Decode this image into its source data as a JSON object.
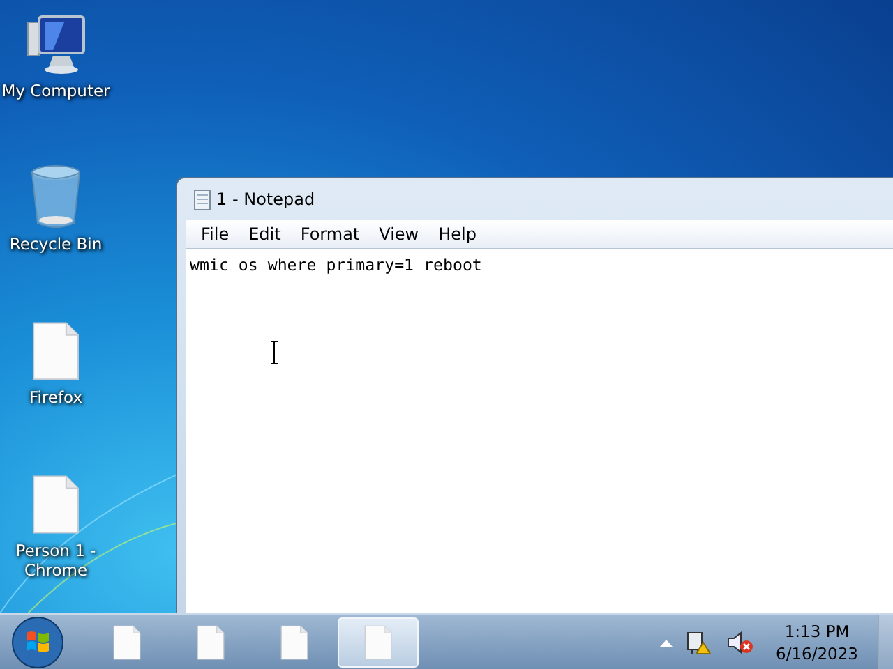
{
  "desktop_icons": [
    {
      "label": "My Computer",
      "kind": "computer"
    },
    {
      "label": "Recycle Bin",
      "kind": "recycle"
    },
    {
      "label": "Firefox",
      "kind": "file"
    },
    {
      "label": "Person 1 - Chrome",
      "kind": "file"
    }
  ],
  "notepad": {
    "title": "1 - Notepad",
    "menu": [
      "File",
      "Edit",
      "Format",
      "View",
      "Help"
    ],
    "text": "wmic os where primary=1 reboot"
  },
  "taskbar": {
    "buttons": [
      {
        "selected": false
      },
      {
        "selected": false
      },
      {
        "selected": false
      },
      {
        "selected": true
      }
    ],
    "time": "1:13 PM",
    "date": "6/16/2023"
  }
}
